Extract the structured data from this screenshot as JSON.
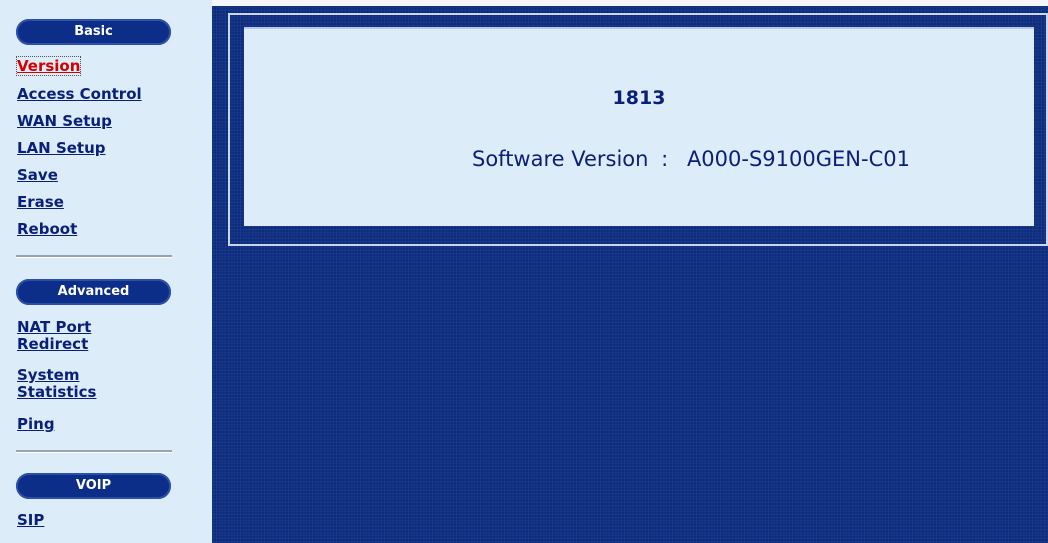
{
  "sidebar": {
    "sections": [
      {
        "title": "Basic",
        "items": [
          {
            "label": "Version",
            "active": true
          },
          {
            "label": "Access Control"
          },
          {
            "label": "WAN Setup"
          },
          {
            "label": "LAN Setup"
          },
          {
            "label": "Save"
          },
          {
            "label": "Erase"
          },
          {
            "label": "Reboot"
          }
        ]
      },
      {
        "title": "Advanced",
        "items": [
          {
            "label": "NAT Port Redirect"
          },
          {
            "label": "System Statistics"
          },
          {
            "label": "Ping"
          }
        ]
      },
      {
        "title": "VOIP",
        "items": [
          {
            "label": "SIP"
          }
        ]
      }
    ]
  },
  "main": {
    "device_name": "1813",
    "software_version_label": "Software Version",
    "separator": ":",
    "software_version_value": "A000-S9100GEN-C01"
  },
  "colors": {
    "nav_link": "#0a1f78",
    "nav_active": "#d40000",
    "pill_background": "#0c2e88",
    "content_background": "#0f2f82",
    "panel_background": "#dcecf8"
  }
}
